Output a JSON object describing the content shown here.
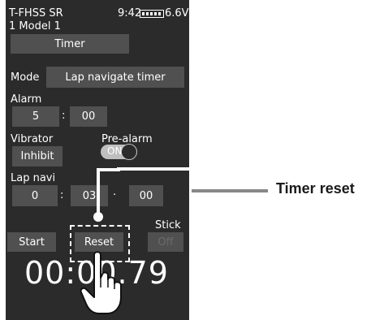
{
  "status_bar": {
    "model_id": "T-FHSS SR",
    "time": "9:42",
    "voltage": "6.6V"
  },
  "model_name": "1  Model 1",
  "screen_title": "Timer",
  "mode": {
    "label": "Mode",
    "value": "Lap navigate timer"
  },
  "alarm": {
    "label": "Alarm",
    "minutes": "5",
    "seconds": "00",
    "separator": ":"
  },
  "vibrator": {
    "label": "Vibrator",
    "value": "Inhibit"
  },
  "pre_alarm": {
    "label": "Pre-alarm",
    "state": "ON"
  },
  "lap_navi": {
    "label": "Lap navi",
    "hours": "0",
    "minutes": "03",
    "seconds": "00",
    "sep1": ":",
    "sep2": "·"
  },
  "stick": {
    "label": "Stick",
    "value": "Off"
  },
  "buttons": {
    "start": "Start",
    "reset": "Reset"
  },
  "timer_display": "00:00.79",
  "callout": {
    "label": "Timer reset"
  },
  "colors": {
    "screen_bg": "#2b2b2b",
    "button_bg": "#505050",
    "callout_line": "#888888"
  }
}
